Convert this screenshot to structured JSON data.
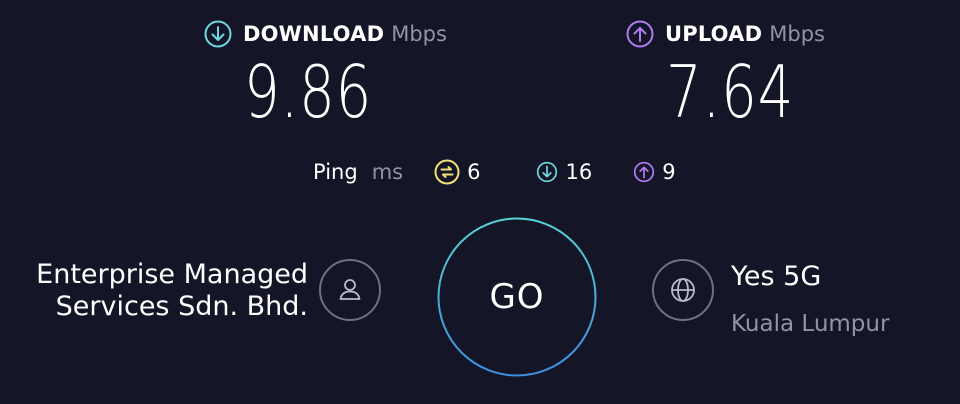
{
  "download": {
    "label": "DOWNLOAD",
    "unit": "Mbps",
    "value": "9.86",
    "icon": "arrow-down-circle-icon",
    "color": "#6fd9e0"
  },
  "upload": {
    "label": "UPLOAD",
    "unit": "Mbps",
    "value": "7.64",
    "icon": "arrow-up-circle-icon",
    "color": "#b27cf2"
  },
  "ping": {
    "label": "Ping",
    "unit": "ms",
    "idle": {
      "value": "6",
      "icon": "ping-idle-icon",
      "color": "#f2e178"
    },
    "download": {
      "value": "16",
      "icon": "arrow-down-circle-icon",
      "color": "#6fd9e0"
    },
    "upload": {
      "value": "9",
      "icon": "arrow-up-circle-icon",
      "color": "#b27cf2"
    }
  },
  "provider": {
    "line1": "Enterprise Managed",
    "line2": "Services Sdn. Bhd.",
    "icon": "person-icon"
  },
  "go_button": {
    "label": "GO"
  },
  "server": {
    "name": "Yes 5G",
    "location": "Kuala Lumpur",
    "icon": "globe-icon"
  }
}
